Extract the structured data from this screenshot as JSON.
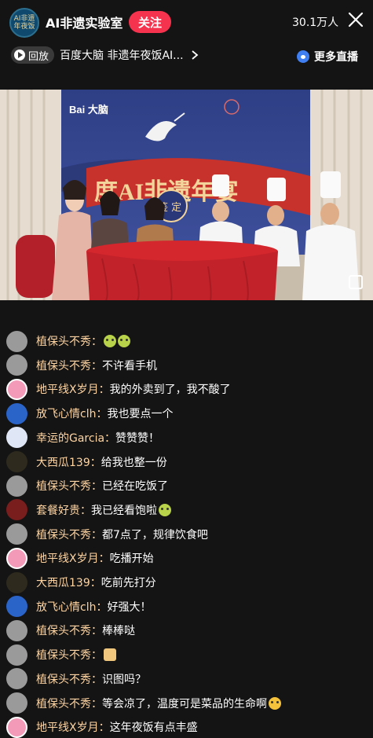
{
  "header": {
    "avatar_text": "AI非遗\n年夜饭",
    "room_name": "AI非遗实验室",
    "follow_label": "关注",
    "viewers": "30.1万人",
    "replay_label": "回放",
    "replay_title": "百度大脑 非遗年夜饭AI...",
    "more_live_label": "更多直播"
  },
  "video": {
    "brand": "Bai 大脑",
    "banner": "度AI非遗年宴",
    "stamp": "鉴 定"
  },
  "chat": {
    "messages": [
      {
        "name": "植保头不秀：",
        "text": "",
        "emoji": "green2",
        "avatar": "grey"
      },
      {
        "name": "植保头不秀：",
        "text": "不许看手机",
        "emoji": "",
        "avatar": "grey"
      },
      {
        "name": "地平线X岁月：",
        "text": "我的外卖到了，我不酸了",
        "emoji": "",
        "avatar": "pink"
      },
      {
        "name": "放飞心情clh：",
        "text": "我也要点一个",
        "emoji": "",
        "avatar": "balloon"
      },
      {
        "name": "幸运的Garcia：",
        "text": "赞赞赞！",
        "emoji": "",
        "avatar": "light"
      },
      {
        "name": "大西瓜139：",
        "text": "给我也整一份",
        "emoji": "",
        "avatar": "dark"
      },
      {
        "name": "植保头不秀：",
        "text": "已经在吃饭了",
        "emoji": "",
        "avatar": "grey"
      },
      {
        "name": "套餐好贵：",
        "text": "我已经看饱啦",
        "emoji": "green",
        "avatar": "car"
      },
      {
        "name": "植保头不秀：",
        "text": "都7点了，规律饮食吧",
        "emoji": "",
        "avatar": "grey"
      },
      {
        "name": "地平线X岁月：",
        "text": "吃播开始",
        "emoji": "",
        "avatar": "pink"
      },
      {
        "name": "大西瓜139：",
        "text": "吃前先打分",
        "emoji": "",
        "avatar": "dark"
      },
      {
        "name": "放飞心情clh：",
        "text": "好强大！",
        "emoji": "",
        "avatar": "balloon"
      },
      {
        "name": "植保头不秀：",
        "text": "棒棒哒",
        "emoji": "",
        "avatar": "grey"
      },
      {
        "name": "植保头不秀：",
        "text": "",
        "emoji": "thumb",
        "avatar": "grey"
      },
      {
        "name": "植保头不秀：",
        "text": "识图吗？",
        "emoji": "",
        "avatar": "grey"
      },
      {
        "name": "植保头不秀：",
        "text": "等会凉了，温度可是菜品的生命啊",
        "emoji": "yellow",
        "avatar": "grey"
      },
      {
        "name": "地平线X岁月：",
        "text": "这年夜饭有点丰盛",
        "emoji": "",
        "avatar": "pink"
      }
    ]
  },
  "colors": {
    "follow": "#f5334f",
    "username": "#ffd5a3",
    "background": "#141414",
    "brand_blue": "#3f7ff2"
  }
}
